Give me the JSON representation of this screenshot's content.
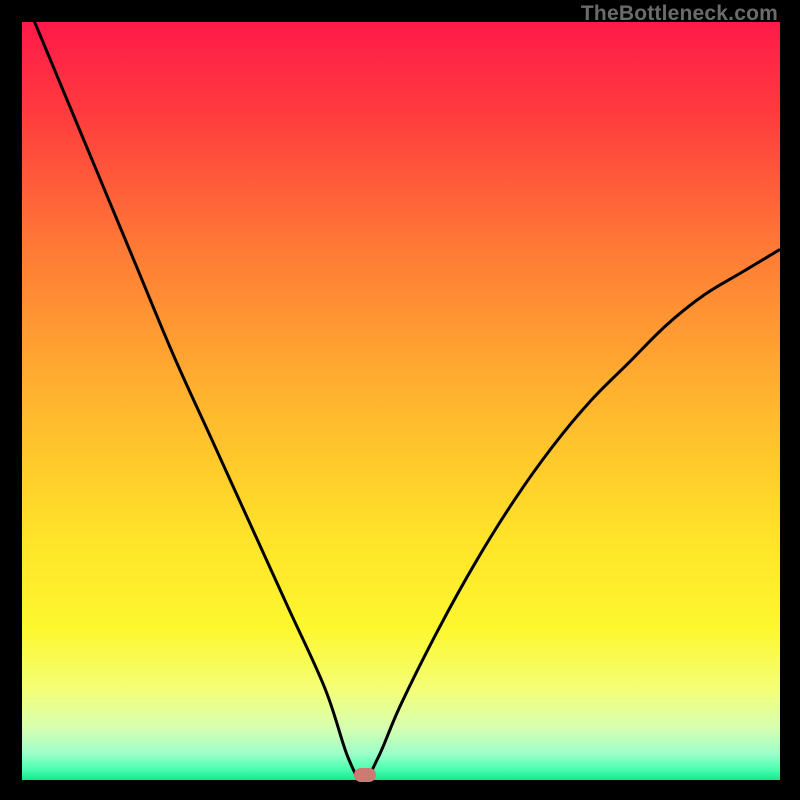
{
  "watermark": "TheBottleneck.com",
  "chart_data": {
    "type": "line",
    "title": "",
    "xlabel": "",
    "ylabel": "",
    "xlim": [
      0,
      100
    ],
    "ylim": [
      0,
      100
    ],
    "series": [
      {
        "name": "bottleneck-curve",
        "x": [
          0,
          5,
          10,
          15,
          20,
          25,
          30,
          35,
          40,
          43,
          45,
          47,
          50,
          55,
          60,
          65,
          70,
          75,
          80,
          85,
          90,
          95,
          100
        ],
        "values": [
          104,
          92,
          80,
          68,
          56,
          45,
          34,
          23,
          12,
          3,
          0,
          3,
          10,
          20,
          29,
          37,
          44,
          50,
          55,
          60,
          64,
          67,
          70
        ]
      }
    ],
    "gradient_stops": [
      {
        "pct": 0,
        "color": "#ff1a49"
      },
      {
        "pct": 12,
        "color": "#ff3b3e"
      },
      {
        "pct": 30,
        "color": "#ff7a36"
      },
      {
        "pct": 50,
        "color": "#ffb52e"
      },
      {
        "pct": 68,
        "color": "#ffe329"
      },
      {
        "pct": 80,
        "color": "#fdf72f"
      },
      {
        "pct": 88,
        "color": "#f4ff76"
      },
      {
        "pct": 93,
        "color": "#d8ffb0"
      },
      {
        "pct": 96.5,
        "color": "#9dffc9"
      },
      {
        "pct": 98.5,
        "color": "#4effb2"
      },
      {
        "pct": 100,
        "color": "#17e88c"
      }
    ],
    "marker": {
      "x": 45.2,
      "y": 0.6,
      "color": "#cc7a72"
    },
    "curve_color": "#000000",
    "curve_width": 3
  }
}
